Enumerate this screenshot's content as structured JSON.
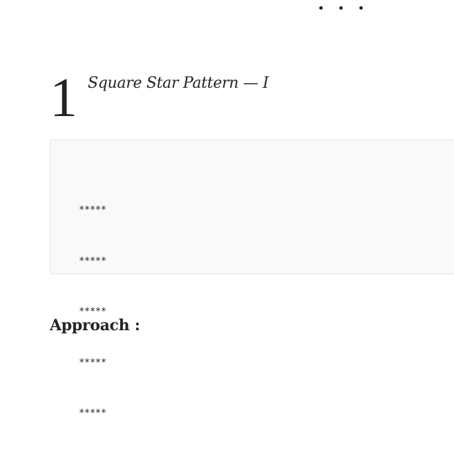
{
  "section": {
    "number": "1",
    "title": "Square Star Pattern — I"
  },
  "code": {
    "lines": [
      "*****",
      "*****",
      "*****",
      "*****",
      "*****"
    ]
  },
  "approach": {
    "heading": "Approach :"
  },
  "colors": {
    "text": "#242424",
    "code_background": "#f9f9f9",
    "code_border": "#e5e5e5"
  }
}
